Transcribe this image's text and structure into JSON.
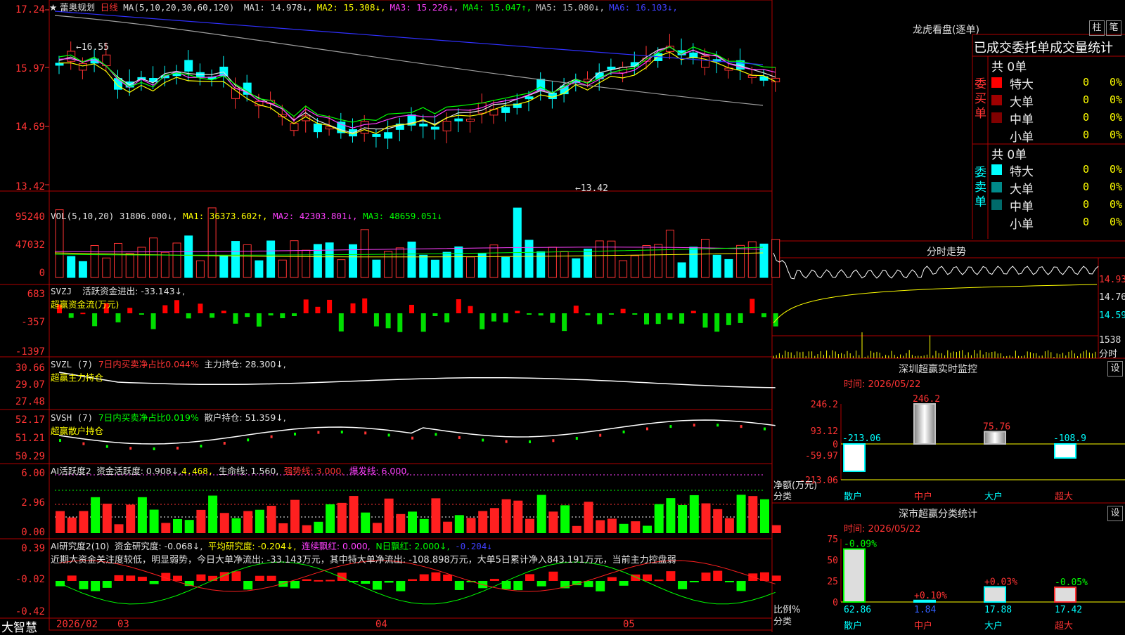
{
  "stock_title": "★ 蕾奥规划",
  "period": "日线",
  "ma_header": {
    "label": "MA(5,10,20,30,60,120)",
    "items": [
      {
        "name": "MA1:",
        "value": "14.978",
        "arrow": "↓",
        "color": "#e0e0e0"
      },
      {
        "name": "MA2:",
        "value": "15.308",
        "arrow": "↓",
        "color": "#ffff00"
      },
      {
        "name": "MA3:",
        "value": "15.226",
        "arrow": "↓",
        "color": "#ff40ff"
      },
      {
        "name": "MA4:",
        "value": "15.047",
        "arrow": "↑",
        "color": "#00ff00"
      },
      {
        "name": "MA5:",
        "value": "15.080",
        "arrow": "↓",
        "color": "#c0c0c0"
      },
      {
        "name": "MA6:",
        "value": "16.103",
        "arrow": "↓",
        "color": "#4040ff"
      }
    ]
  },
  "price_axis": [
    "17.24",
    "15.97",
    "14.69",
    "13.42"
  ],
  "high_marker": "16.55",
  "low_marker": "13.42",
  "vol": {
    "label": "VOL(5,10,20)",
    "value": "31806.000↓,",
    "ma1": "MA1: 36373.602↑,",
    "ma2": "MA2: 42303.801↓,",
    "ma3": "MA3: 48659.051↓",
    "axis": [
      "95240",
      "47032",
      "0"
    ]
  },
  "svzj": {
    "label": "SVZJ",
    "text": "活跃资金进出: -33.143↓,",
    "sub": "超赢资金流(万元)",
    "axis": [
      "683",
      "-357",
      "-1397"
    ]
  },
  "svzl": {
    "label": "SVZL (7)",
    "pct": "7日内买卖净占比0.044%",
    "text": "主力持仓: 28.300↓,",
    "sub": "超赢主力持仓",
    "axis": [
      "30.66",
      "29.07",
      "27.48"
    ]
  },
  "svsh": {
    "label": "SVSH (7)",
    "pct": "7日内买卖净占比0.019%",
    "text": "散户持仓: 51.359↓,",
    "sub": "超赢散户持仓",
    "axis": [
      "52.17",
      "51.21",
      "50.29"
    ]
  },
  "ai1": {
    "label": "AI活跃度2",
    "a": "资金活跃度: 0.908↓,",
    "b": "4.468,",
    "c": "生命线: 1.560,",
    "d": "强势线: 3.000,",
    "e": "爆发线: 6.000,",
    "axis": [
      "6.00",
      "2.96",
      "0.00"
    ]
  },
  "ai2": {
    "label": "AI研究度2(10)",
    "a": "资金研究度: -0.068↓,",
    "b": "平均研究度: -0.204↓,",
    "c": "连续飘红: 0.000,",
    "d": "N日飘红: 2.000↓,",
    "e": "-0.204↓",
    "axis": [
      "0.39",
      "-0.02",
      "-0.42"
    ],
    "comment": "近期大资金关注度较低，明显弱势，今日大单净流出: -33.143万元，其中特大单净流出: -108.898万元，大单5日累计净入843.191万元，当前主力控盘弱"
  },
  "x_axis": {
    "brand": "大智慧",
    "dates": [
      "2026/02",
      "03",
      "04",
      "05"
    ]
  },
  "right": {
    "lhkp_title": "龙虎看盘(逐单)",
    "btn_zhu": "柱",
    "btn_bi": "笔",
    "stat_title": "已成交委托单成交量统计",
    "buy": {
      "side": "委买单",
      "total": "共 0单",
      "rows": [
        {
          "name": "特大",
          "v": "0",
          "p": "0%",
          "color": "#ff0000"
        },
        {
          "name": "大单",
          "v": "0",
          "p": "0%",
          "color": "#a00000"
        },
        {
          "name": "中单",
          "v": "0",
          "p": "0%",
          "color": "#800000"
        },
        {
          "name": "小单",
          "v": "0",
          "p": "0%",
          "color": ""
        }
      ]
    },
    "sell": {
      "side": "委卖单",
      "total": "共 0单",
      "rows": [
        {
          "name": "特大",
          "v": "0",
          "p": "0%",
          "color": "#00ffff"
        },
        {
          "name": "大单",
          "v": "0",
          "p": "0%",
          "color": "#008a8a"
        },
        {
          "name": "中单",
          "v": "0",
          "p": "0%",
          "color": "#006a6a"
        },
        {
          "name": "小单",
          "v": "0",
          "p": "0%",
          "color": ""
        }
      ]
    },
    "intraday_title": "分时走势",
    "intraday_axis": [
      "14.93",
      "14.76",
      "14.59"
    ],
    "intraday_vol": "1538",
    "intraday_vol_unit": "分时",
    "sz_monitor_title": "深圳超赢实时监控",
    "btn_set": "设",
    "time_label": "时间: 2026/05/22",
    "monitor_axis": [
      "246.2",
      "93.12",
      "0",
      "-59.97",
      "-213.06"
    ],
    "monitor_bars": [
      {
        "cat": "散户",
        "value": -213.06
      },
      {
        "cat": "中户",
        "value": 246.2
      },
      {
        "cat": "大户",
        "value": 75.76
      },
      {
        "cat": "超大",
        "value": -108.9
      }
    ],
    "net_label": "净额(万元)",
    "cls_label": "分类",
    "cls_title": "深市超赢分类统计",
    "cls_axis": [
      "75",
      "50",
      "25",
      "0"
    ],
    "cls_bars": [
      {
        "cat": "散户",
        "top": "-0.09%",
        "bottom": "62.86",
        "value": 62.86
      },
      {
        "cat": "中户",
        "top": "+0.10%",
        "bottom": "1.84",
        "value": 1.84
      },
      {
        "cat": "大户",
        "top": "+0.03%",
        "bottom": "17.88",
        "value": 17.88
      },
      {
        "cat": "超大",
        "top": "-0.05%",
        "bottom": "17.42",
        "value": 17.42
      }
    ],
    "ratio_label": "比例%",
    "cls_label2": "分类"
  },
  "colors": {
    "up": "#ff3333",
    "down": "#00ffff",
    "grid": "#b00000"
  }
}
